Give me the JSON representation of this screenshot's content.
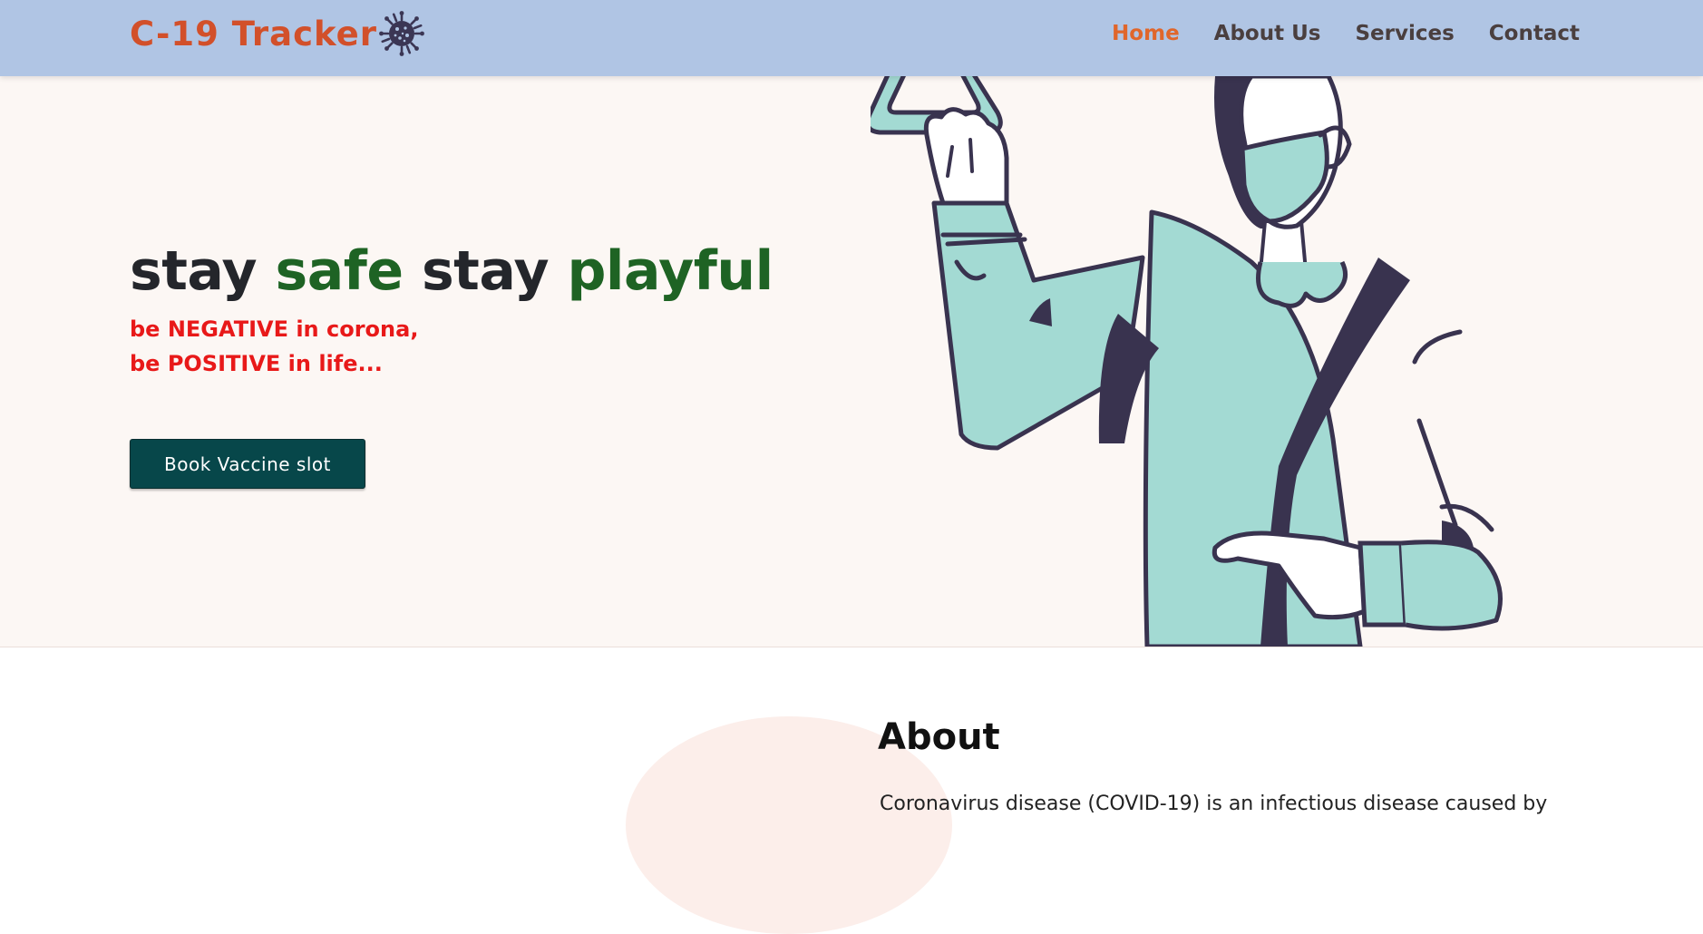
{
  "header": {
    "brand": "C-19 Tracker",
    "brand_icon": "virus-icon",
    "nav": [
      {
        "label": "Home",
        "active": true
      },
      {
        "label": "About Us",
        "active": false
      },
      {
        "label": "Services",
        "active": false
      },
      {
        "label": "Contact",
        "active": false
      }
    ]
  },
  "hero": {
    "title_parts": [
      "stay",
      "safe",
      "stay",
      "playful"
    ],
    "tagline_line1": "be NEGATIVE in corona,",
    "tagline_line2": "be POSITIVE in life...",
    "cta_label": "Book Vaccine slot",
    "illustration": "masked-woman-holding-strap-illustration"
  },
  "about": {
    "heading": "About",
    "text": "Coronavirus disease (COVID-19) is an infectious disease caused by"
  },
  "colors": {
    "navbar_bg": "#b0c5e4",
    "brand": "#d2502a",
    "nav_active": "#e0662b",
    "title_green": "#1e6324",
    "tagline_red": "#e81919",
    "cta_bg": "#07474a",
    "mint": "#a3dad3",
    "navy": "#39334f"
  }
}
